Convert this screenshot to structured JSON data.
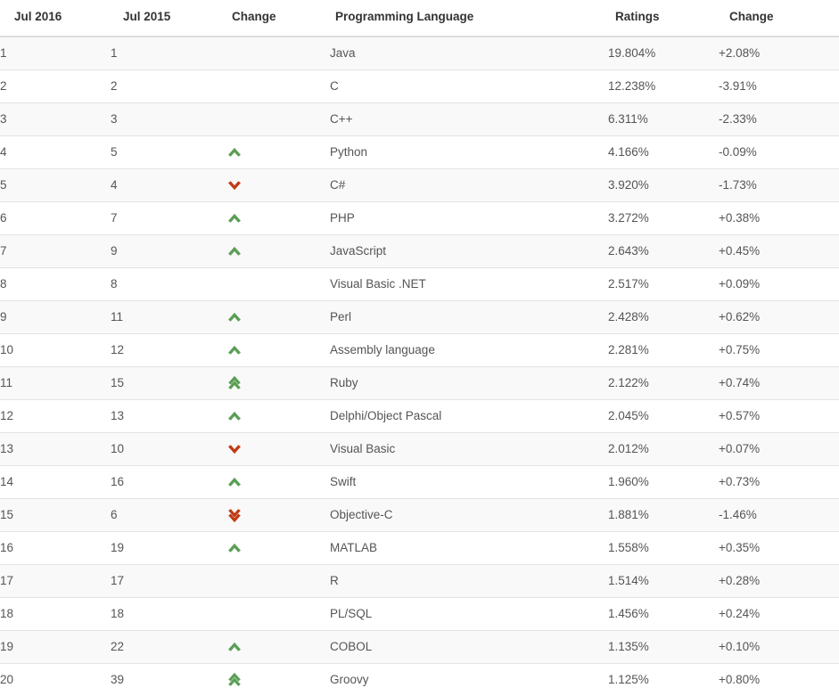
{
  "table": {
    "columns": [
      {
        "key": "rank_current",
        "label": "Jul 2016"
      },
      {
        "key": "rank_previous",
        "label": "Jul 2015"
      },
      {
        "key": "change_arrow",
        "label": "Change"
      },
      {
        "key": "language",
        "label": "Programming Language"
      },
      {
        "key": "ratings",
        "label": "Ratings"
      },
      {
        "key": "change_pct",
        "label": "Change"
      }
    ],
    "colors": {
      "arrow_up": "#5a9e55",
      "arrow_down": "#bf3b15",
      "stripe": "#f9f9f9",
      "row_border": "#e3e3e3",
      "header_border": "#dddddd",
      "header_text": "#333333",
      "body_text": "#555555"
    },
    "rows": [
      {
        "rank_current": "1",
        "rank_previous": "1",
        "change_arrow": "none",
        "language": "Java",
        "ratings": "19.804%",
        "change_pct": "+2.08%"
      },
      {
        "rank_current": "2",
        "rank_previous": "2",
        "change_arrow": "none",
        "language": "C",
        "ratings": "12.238%",
        "change_pct": "-3.91%"
      },
      {
        "rank_current": "3",
        "rank_previous": "3",
        "change_arrow": "none",
        "language": "C++",
        "ratings": "6.311%",
        "change_pct": "-2.33%"
      },
      {
        "rank_current": "4",
        "rank_previous": "5",
        "change_arrow": "up",
        "language": "Python",
        "ratings": "4.166%",
        "change_pct": "-0.09%"
      },
      {
        "rank_current": "5",
        "rank_previous": "4",
        "change_arrow": "down",
        "language": "C#",
        "ratings": "3.920%",
        "change_pct": "-1.73%"
      },
      {
        "rank_current": "6",
        "rank_previous": "7",
        "change_arrow": "up",
        "language": "PHP",
        "ratings": "3.272%",
        "change_pct": "+0.38%"
      },
      {
        "rank_current": "7",
        "rank_previous": "9",
        "change_arrow": "up",
        "language": "JavaScript",
        "ratings": "2.643%",
        "change_pct": "+0.45%"
      },
      {
        "rank_current": "8",
        "rank_previous": "8",
        "change_arrow": "none",
        "language": "Visual Basic .NET",
        "ratings": "2.517%",
        "change_pct": "+0.09%"
      },
      {
        "rank_current": "9",
        "rank_previous": "11",
        "change_arrow": "up",
        "language": "Perl",
        "ratings": "2.428%",
        "change_pct": "+0.62%"
      },
      {
        "rank_current": "10",
        "rank_previous": "12",
        "change_arrow": "up",
        "language": "Assembly language",
        "ratings": "2.281%",
        "change_pct": "+0.75%"
      },
      {
        "rank_current": "11",
        "rank_previous": "15",
        "change_arrow": "double-up",
        "language": "Ruby",
        "ratings": "2.122%",
        "change_pct": "+0.74%"
      },
      {
        "rank_current": "12",
        "rank_previous": "13",
        "change_arrow": "up",
        "language": "Delphi/Object Pascal",
        "ratings": "2.045%",
        "change_pct": "+0.57%"
      },
      {
        "rank_current": "13",
        "rank_previous": "10",
        "change_arrow": "down",
        "language": "Visual Basic",
        "ratings": "2.012%",
        "change_pct": "+0.07%"
      },
      {
        "rank_current": "14",
        "rank_previous": "16",
        "change_arrow": "up",
        "language": "Swift",
        "ratings": "1.960%",
        "change_pct": "+0.73%"
      },
      {
        "rank_current": "15",
        "rank_previous": "6",
        "change_arrow": "double-down",
        "language": "Objective-C",
        "ratings": "1.881%",
        "change_pct": "-1.46%"
      },
      {
        "rank_current": "16",
        "rank_previous": "19",
        "change_arrow": "up",
        "language": "MATLAB",
        "ratings": "1.558%",
        "change_pct": "+0.35%"
      },
      {
        "rank_current": "17",
        "rank_previous": "17",
        "change_arrow": "none",
        "language": "R",
        "ratings": "1.514%",
        "change_pct": "+0.28%"
      },
      {
        "rank_current": "18",
        "rank_previous": "18",
        "change_arrow": "none",
        "language": "PL/SQL",
        "ratings": "1.456%",
        "change_pct": "+0.24%"
      },
      {
        "rank_current": "19",
        "rank_previous": "22",
        "change_arrow": "up",
        "language": "COBOL",
        "ratings": "1.135%",
        "change_pct": "+0.10%"
      },
      {
        "rank_current": "20",
        "rank_previous": "39",
        "change_arrow": "double-up",
        "language": "Groovy",
        "ratings": "1.125%",
        "change_pct": "+0.80%"
      }
    ]
  }
}
